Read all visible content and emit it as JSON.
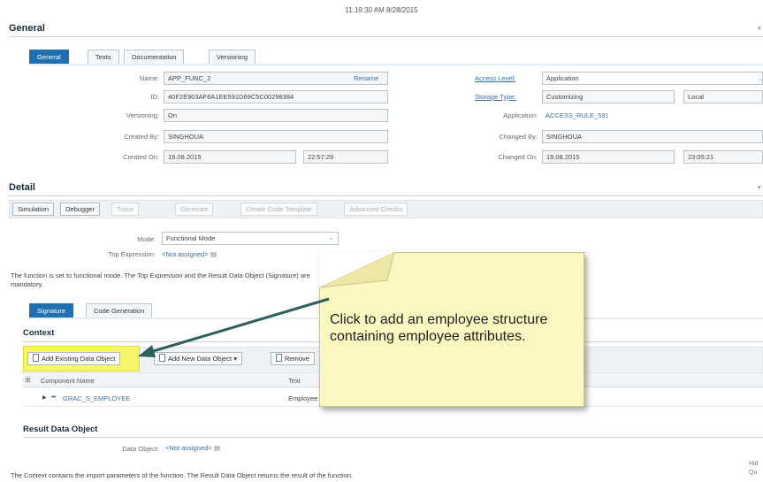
{
  "timestamp": "11:19:30 AM 8/28/2015",
  "general": {
    "title": "General",
    "tabs": [
      "General",
      "Texts",
      "Documentation",
      "Versioning"
    ],
    "name_label": "Name:",
    "name_value": "APP_FUNC_2",
    "rename_link": "Rename",
    "id_label": "ID:",
    "id_value": "40F2E903AF6A1EE591D69C5C00298384",
    "versioning_label": "Versioning:",
    "versioning_value": "On",
    "created_by_label": "Created By:",
    "created_by_value": "SINGHOUA",
    "created_on_label": "Created On:",
    "created_on_date": "19.08.2015",
    "created_on_time": "22:57:29",
    "access_level_label": "Access Level:",
    "access_level_value": "Application",
    "storage_type_label": "Storage Type:",
    "storage_type_value": "Customizing",
    "storage_type_scope": "Local",
    "application_label": "Application:",
    "application_value": "ACCESS_RULE_591",
    "changed_by_label": "Changed By:",
    "changed_by_value": "SINGHOUA",
    "changed_on_label": "Changed On:",
    "changed_on_date": "19.08.2015",
    "changed_on_time": "23:05:21"
  },
  "detail": {
    "title": "Detail",
    "toolbar": [
      "Simulation",
      "Debugger",
      "Trace",
      "Generate",
      "Create Code Template",
      "Advanced Checks"
    ],
    "mode_label": "Mode:",
    "mode_value": "Functional Mode",
    "top_expression_label": "Top Expression:",
    "top_expression_value": "<Not assigned>",
    "message": "The function is set to functional mode. The Top Expression and the Result Data Object (Signature) are mandatory.",
    "sub_tabs": [
      "Signature",
      "Code Generation"
    ]
  },
  "context": {
    "title": "Context",
    "buttons": [
      "Add Existing Data Object",
      "Add New Data Object",
      "Remove"
    ],
    "columns": [
      "Component Name",
      "Text"
    ],
    "rows": [
      {
        "name": "GRAC_S_EMPLOYEE",
        "text": "Employee"
      }
    ]
  },
  "result": {
    "title": "Result Data Object",
    "data_object_label": "Data Object:",
    "data_object_value": "<Not assigned>"
  },
  "footer_message": "The Context contains the import parameters of the function. The Result Data Object returns the result of the function.",
  "corner_text": [
    "Hid",
    "Qu"
  ],
  "callout": {
    "text": "Click to add an employee structure containing employee attributes."
  },
  "colors": {
    "accent": "#1f70b0",
    "highlight": "#f7f56a",
    "callout": "#fbf7c1",
    "arrow": "#2e5f5c"
  }
}
